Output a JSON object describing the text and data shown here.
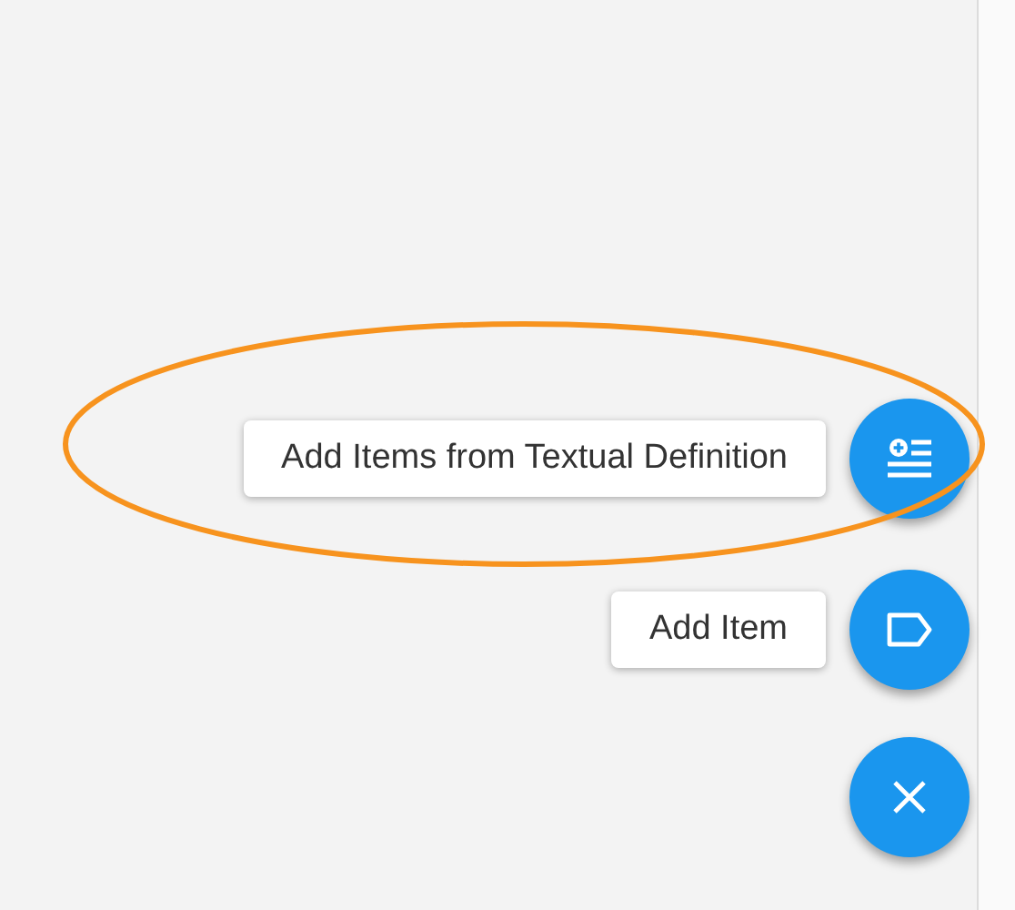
{
  "actions": [
    {
      "label": "Add Items from Textual Definition",
      "kind": "add-list",
      "highlighted": true
    },
    {
      "label": "Add Item",
      "kind": "tag",
      "highlighted": false
    }
  ],
  "close_button": {
    "kind": "close"
  }
}
